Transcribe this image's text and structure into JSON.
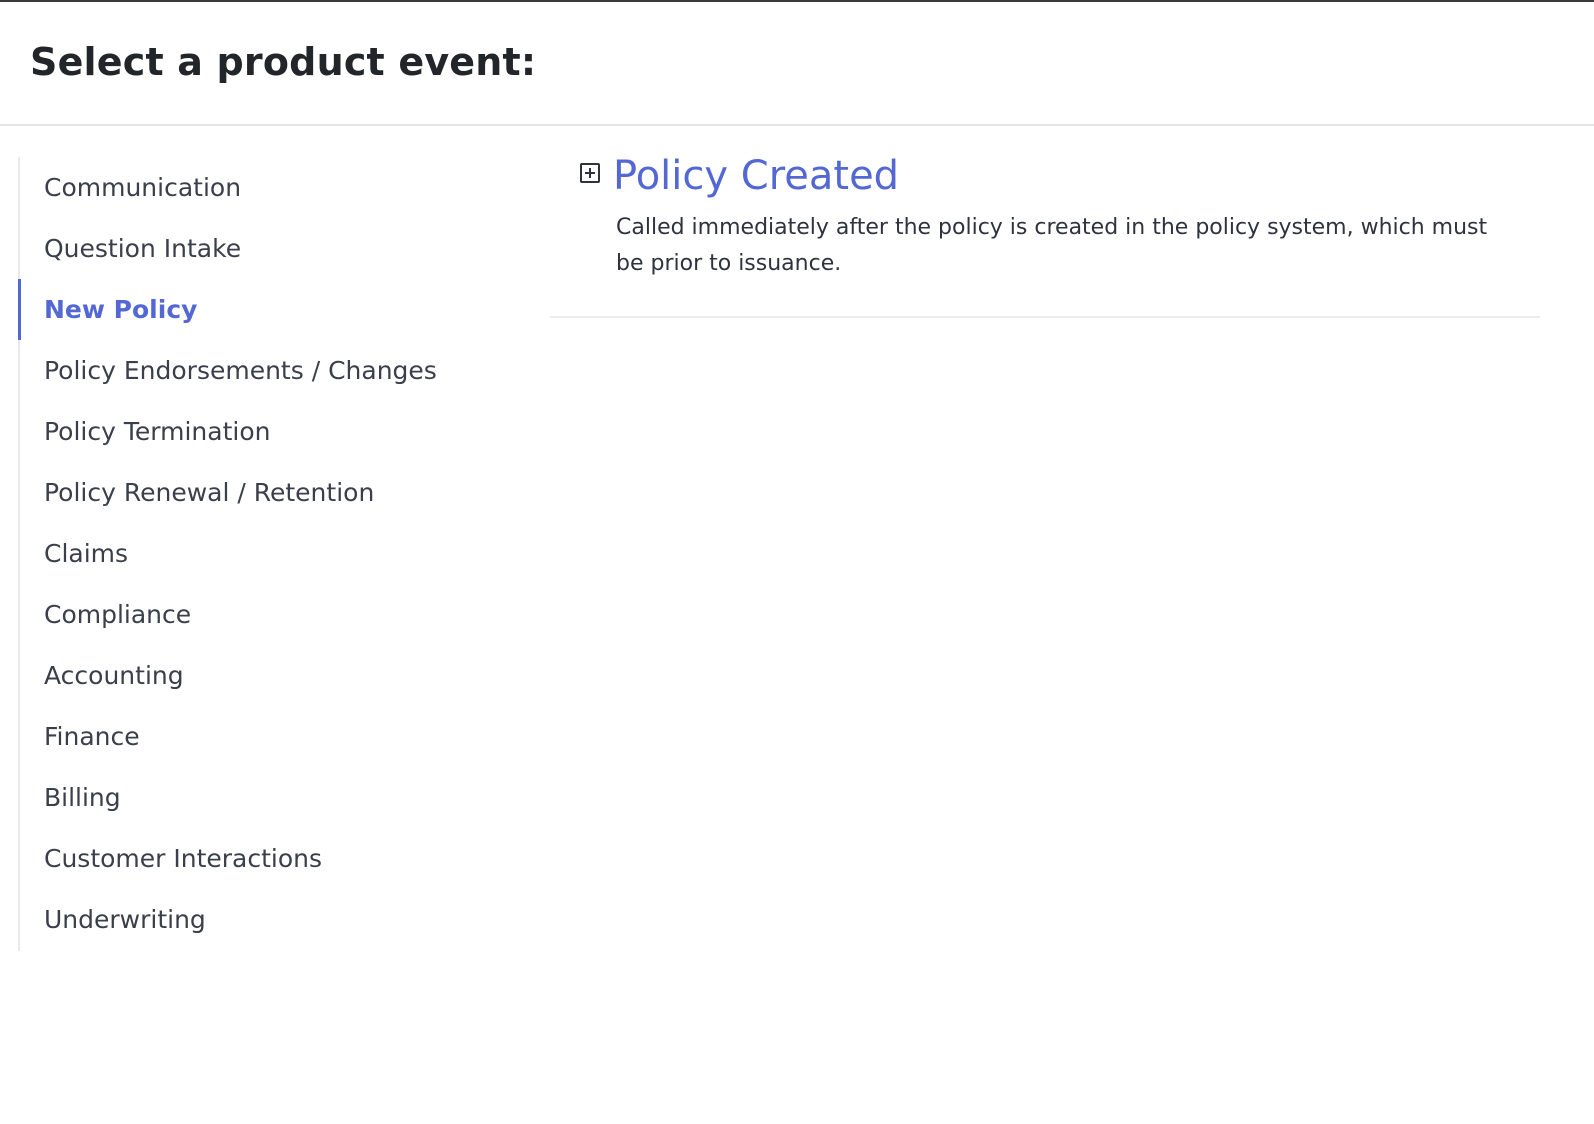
{
  "header": {
    "title": "Select a product event:"
  },
  "sidebar": {
    "items": [
      {
        "label": "Communication"
      },
      {
        "label": "Question Intake"
      },
      {
        "label": "New Policy",
        "active": true
      },
      {
        "label": "Policy Endorsements / Changes"
      },
      {
        "label": "Policy Termination"
      },
      {
        "label": "Policy Renewal / Retention"
      },
      {
        "label": "Claims"
      },
      {
        "label": "Compliance"
      },
      {
        "label": "Accounting"
      },
      {
        "label": "Finance"
      },
      {
        "label": "Billing"
      },
      {
        "label": "Customer Interactions"
      },
      {
        "label": "Underwriting"
      }
    ]
  },
  "main": {
    "events": [
      {
        "icon": "expand-plus-icon",
        "title": "Policy Created",
        "description": "Called immediately after the policy is created in the policy system, which must be prior to issuance."
      }
    ]
  },
  "colors": {
    "accent": "#5468d4",
    "text": "#2f3340",
    "divider": "#e6e6e6"
  }
}
